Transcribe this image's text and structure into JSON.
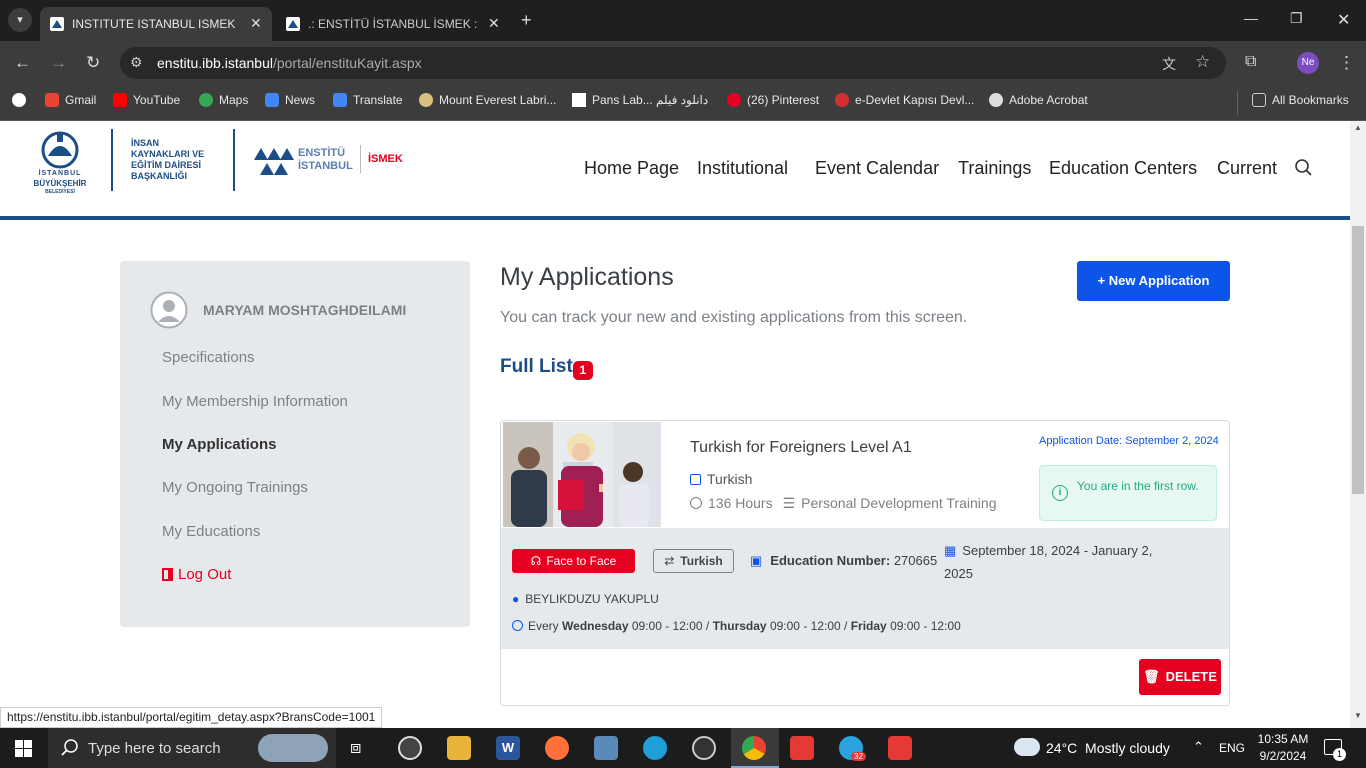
{
  "browser": {
    "tabs": [
      {
        "title": "INSTITUTE ISTANBUL ISMEK",
        "active": true
      },
      {
        "title": ".: ENSTİTÜ İSTANBUL İSMEK :. Y",
        "active": false
      }
    ],
    "url_host": "enstitu.ibb.istanbul",
    "url_path": "/portal/enstituKayit.aspx",
    "profile": "Ne",
    "bookmarks": [
      "Gmail",
      "YouTube",
      "Maps",
      "News",
      "Translate",
      "Mount Everest Labri...",
      "Pans Lab... دانلود فیلم",
      "(26) Pinterest",
      "e-Devlet Kapısı Devl...",
      "Adobe Acrobat"
    ],
    "all_bookmarks": "All Bookmarks",
    "status_url": "https://enstitu.ibb.istanbul/portal/egitim_detay.aspx?BransCode=1001"
  },
  "header": {
    "logo_ibb_line1": "İSTANBUL",
    "logo_ibb_line2": "BÜYÜKŞEHİR",
    "logo_ibb_line3": "BELEDİYESİ",
    "dept_line1": "İNSAN",
    "dept_line2": "KAYNAKLARI VE",
    "dept_line3": "EĞİTİM DAİRESİ",
    "dept_line4": "BAŞKANLIĞI",
    "enstitu_line1": "ENSTİTÜ",
    "enstitu_line2": "İSTANBUL",
    "ismek": "İSMEK",
    "nav": [
      "Home Page",
      "Institutional",
      "Event Calendar",
      "Trainings",
      "Education Centers",
      "Current"
    ]
  },
  "sidebar": {
    "user_name": "MARYAM MOSHTAGHDEILAMI",
    "items": [
      "Specifications",
      "My Membership Information",
      "My Applications",
      "My Ongoing Trainings",
      "My Educations"
    ],
    "active_item": "My Applications",
    "logout": "Log Out"
  },
  "main": {
    "title": "My Applications",
    "subtitle": "You can track your new and existing applications from this screen.",
    "new_button": "+ New Application",
    "full_list_label": "Full List",
    "full_list_count": "1",
    "application": {
      "course_title": "Turkish for Foreigners Level A1",
      "language": "Turkish",
      "hours": "136 Hours",
      "category": "Personal Development Training",
      "application_date": "Application Date: September 2, 2024",
      "queue_status": "You are in the first row.",
      "mode_badge": "Face to Face",
      "language_badge": "Turkish",
      "education_number_label": "Education Number:",
      "education_number": "270665",
      "date_range": "September 18, 2024 - January 2, 2025",
      "location": "BEYLIKDUZU YAKUPLU",
      "schedule_every": "Every",
      "schedule": [
        {
          "day": "Wednesday",
          "time": "09:00 - 12:00"
        },
        {
          "day": "Thursday",
          "time": "09:00 - 12:00"
        },
        {
          "day": "Friday",
          "time": "09:00 - 12:00"
        }
      ],
      "delete_button": "DELETE"
    }
  },
  "taskbar": {
    "search_placeholder": "Type here to search",
    "weather": "24°C  Mostly cloudy",
    "lang": "ENG",
    "time": "10:35 AM",
    "date": "9/2/2024",
    "telegram_badge": "32",
    "notif_count": "1"
  },
  "colors": {
    "brand_blue": "#1b4e86",
    "primary_button": "#0d55e8",
    "danger": "#e5001f",
    "success_bg": "#e6f8ef",
    "success_text": "#1fab89"
  }
}
